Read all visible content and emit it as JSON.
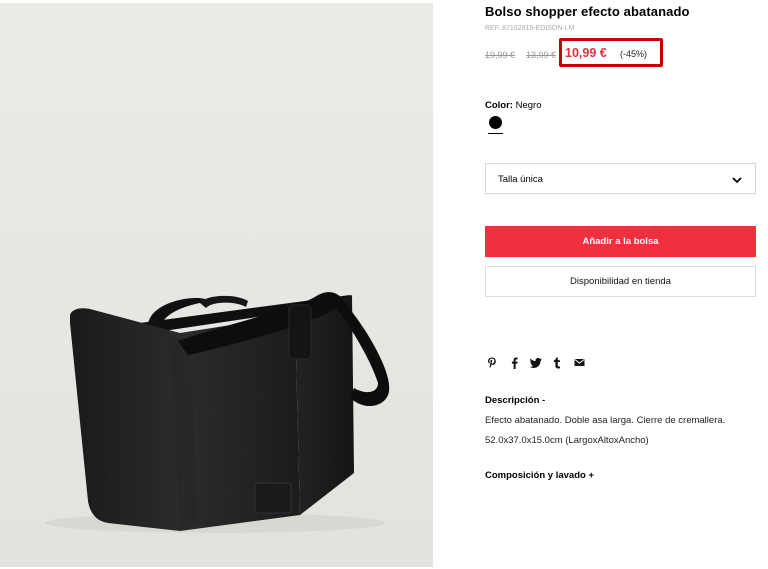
{
  "product": {
    "title": "Bolso shopper efecto abatanado",
    "reference": "REF. 87102915-EDISON-LM",
    "original_price_1": "19,99 €",
    "original_price_2": "13,99 €",
    "sale_price": "10,99 €",
    "discount": "(-45%)",
    "color_label": "Color:",
    "color_value": "Negro",
    "swatch_color": "#000000"
  },
  "size_selector": {
    "value": "Talla única",
    "icon": "chevron-down-icon"
  },
  "actions": {
    "add_to_bag": "Añadir a la bolsa",
    "store_availability": "Disponibilidad en tienda"
  },
  "share_icons": [
    "pinterest-icon",
    "facebook-icon",
    "twitter-icon",
    "tumblr-icon",
    "email-icon"
  ],
  "description": {
    "title": "Descripción",
    "toggle": "-",
    "lines": [
      "Efecto abatanado. Doble asa larga. Cierre de cremallera.",
      "52.0x37.0x15.0cm (LargoxAltoxAncho)"
    ]
  },
  "composition": {
    "title": "Composición y lavado",
    "toggle": "+"
  },
  "colors": {
    "accent_red": "#f0303f",
    "price_red": "#e0313f",
    "highlight_border": "#c30000"
  }
}
